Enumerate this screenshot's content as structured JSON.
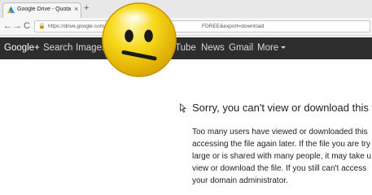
{
  "browser": {
    "tab_title": "Google Drive - Quota exce...",
    "tab_close": "×",
    "new_tab": "+",
    "back": "←",
    "forward": "→",
    "reload": "C",
    "url": "https://drive.google.com/uc?id",
    "url_tail": "FDREE&export=download"
  },
  "google_bar": {
    "items": [
      "Google+",
      "Search",
      "Images",
      "Tube",
      "News",
      "Gmail",
      "More"
    ]
  },
  "error": {
    "heading": "Sorry, you can't view or download this file",
    "lines": [
      "Too many users have viewed or downloaded this",
      "accessing the file again later. If the file you are try",
      "large or is shared with many people, it may take u",
      "view or download the file. If you still can't access",
      "your domain administrator."
    ]
  },
  "colors": {
    "gbar_bg": "#2d2d2d",
    "emoji_face": "#f5d000"
  },
  "overlay": {
    "icon": "neutral-face-emoji"
  }
}
